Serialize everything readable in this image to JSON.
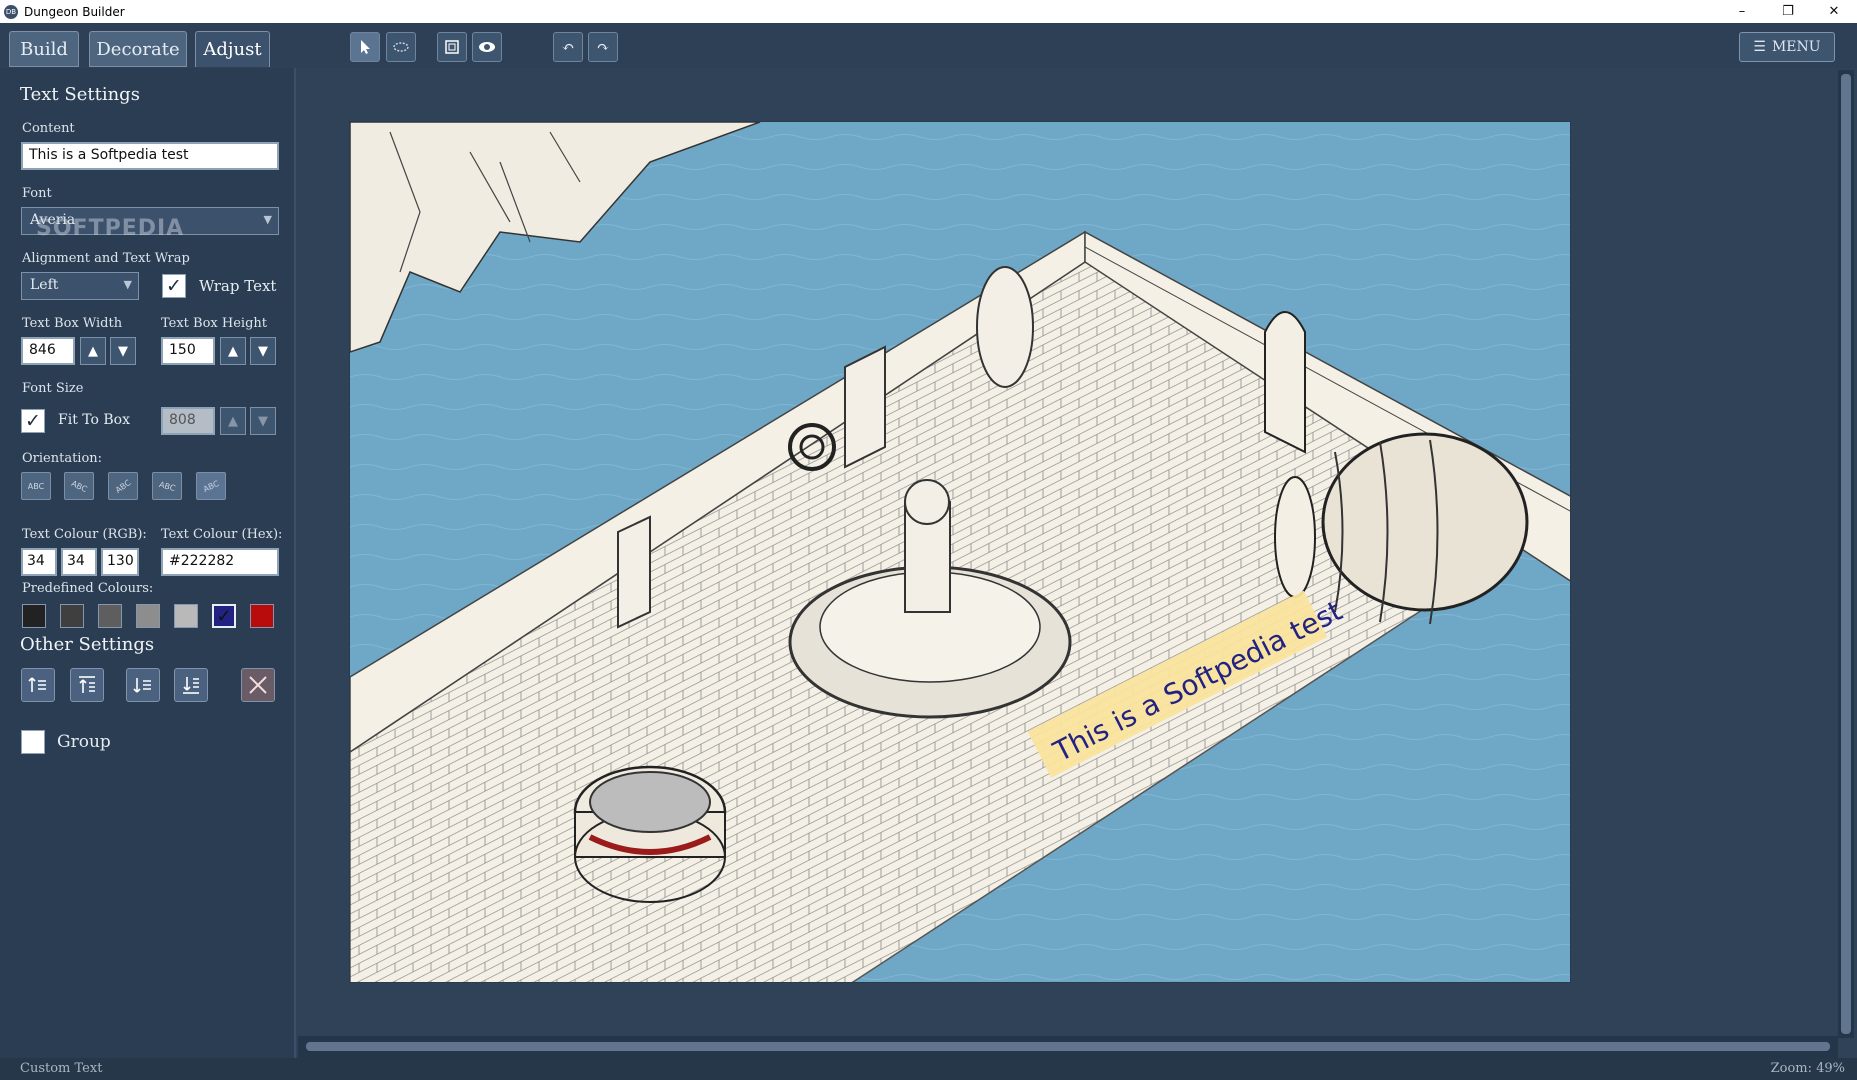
{
  "window": {
    "title": "Dungeon Builder",
    "icon_text": "DB"
  },
  "tabs": [
    {
      "label": "Build"
    },
    {
      "label": "Decorate"
    },
    {
      "label": "Adjust"
    }
  ],
  "toolbar": {
    "icons": [
      "pointer-icon",
      "lasso-icon",
      "frame-icon",
      "eye-icon",
      "undo-icon",
      "redo-icon"
    ],
    "menu_label": "MENU"
  },
  "text_settings": {
    "heading": "Text Settings",
    "content_label": "Content",
    "content_value": "This is a Softpedia test",
    "font_label": "Font",
    "font_value": "Averia",
    "alignment_label": "Alignment and Text Wrap",
    "alignment_value": "Left",
    "wrap_text_label": "Wrap Text",
    "wrap_text_checked": true,
    "width_label": "Text Box Width",
    "width_value": "846",
    "height_label": "Text Box Height",
    "height_value": "150",
    "font_size_label": "Font Size",
    "fit_to_box_label": "Fit To Box",
    "fit_to_box_checked": true,
    "font_size_value": "808",
    "orientation_label": "Orientation:",
    "colour_rgb_label": "Text Colour (RGB):",
    "colour_r": "34",
    "colour_g": "34",
    "colour_b": "130",
    "colour_hex_label": "Text Colour (Hex):",
    "colour_hex": "#222282",
    "predefined_label": "Predefined Colours:",
    "predefined_colours": [
      "#222222",
      "#3f3f3f",
      "#5e5e5e",
      "#8d8d8d",
      "#b9b9b9",
      "#222282",
      "#b80c0c"
    ]
  },
  "other_settings": {
    "heading": "Other Settings",
    "group_label": "Group"
  },
  "watermark": "SOFTPEDIA",
  "map": {
    "text_object": "This is a Softpedia test",
    "water_color": "#6fa8c6",
    "floor_color": "#f3efe6"
  },
  "status": {
    "left": "Custom Text",
    "right": "Zoom: 49%"
  }
}
